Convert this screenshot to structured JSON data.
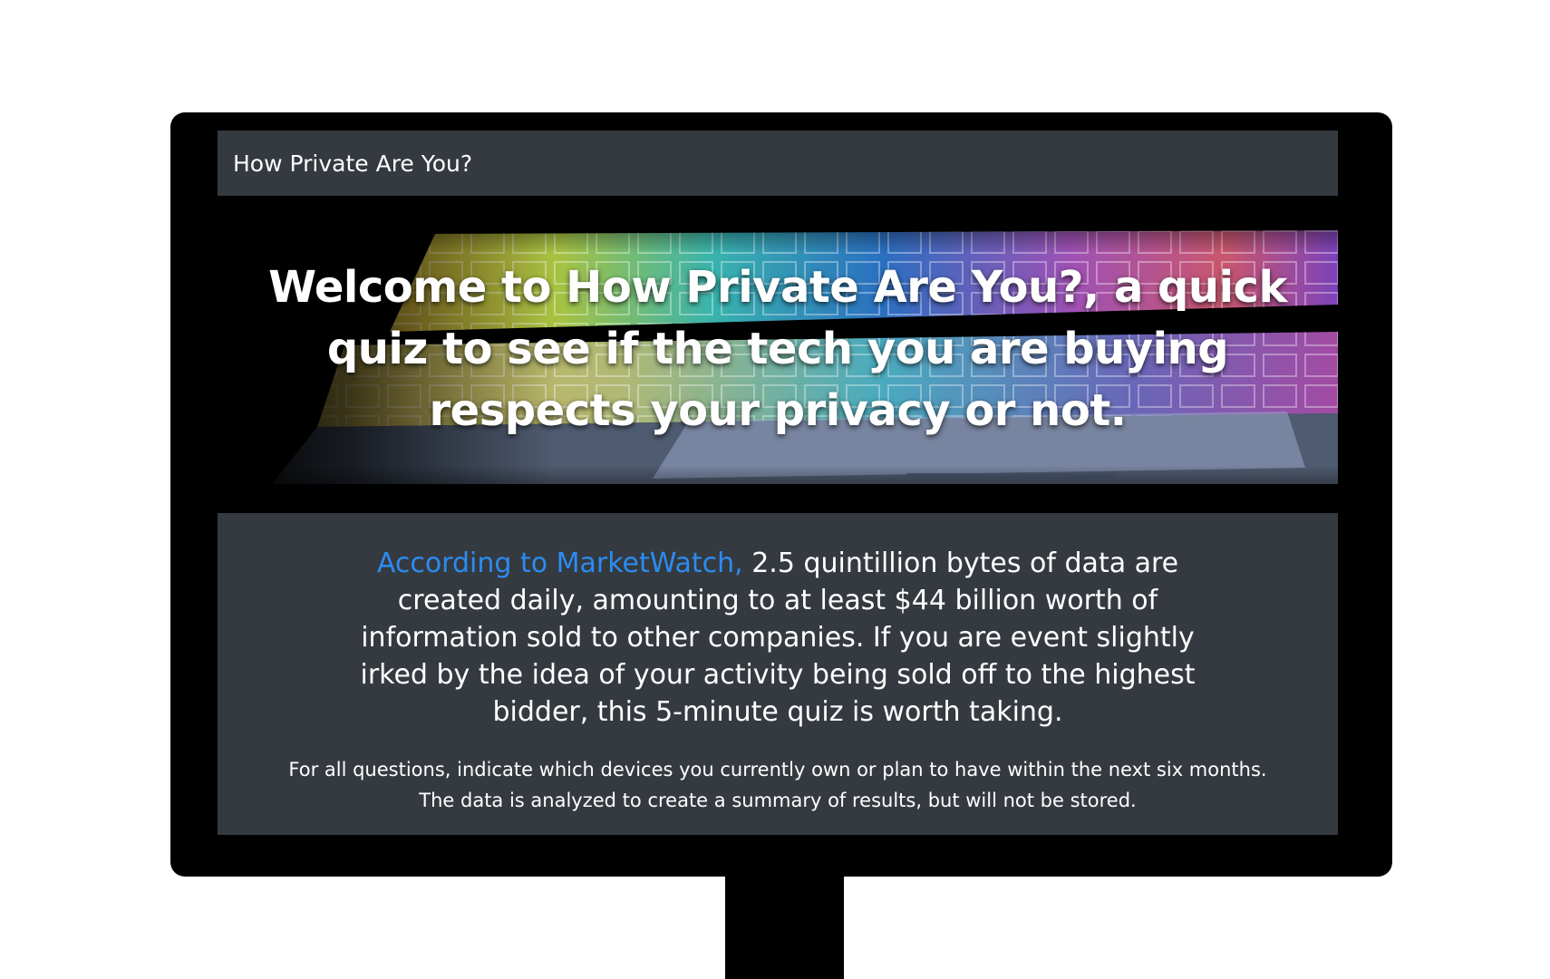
{
  "navbar": {
    "brand": "How Private Are You?"
  },
  "hero": {
    "title": "Welcome to How Private Are You?, a quick quiz to see if the tech you are buying respects your privacy or not.",
    "image": "laptop-keyboard-rainbow-backlight"
  },
  "intro": {
    "source_link": "According to MarketWatch,",
    "lead_text": "2.5 quintillion bytes of data are created daily, amounting to at least $44 billion worth of information sold to other companies. If you are event slightly irked by the idea of your activity being sold off to the highest bidder, this 5-minute quiz is worth taking.",
    "instruction_line1": "For all questions, indicate which devices you currently own or plan to have within the next six months.",
    "instruction_line2": "The data is analyzed to create a summary of results, but will not be stored."
  },
  "colors": {
    "navbar_bg": "#343a40",
    "link": "#2b8cf0",
    "monitor": "#000000"
  }
}
